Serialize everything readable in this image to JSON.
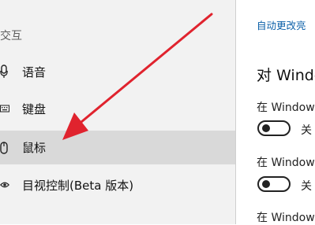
{
  "sidebar": {
    "section_header": "交互",
    "items": [
      {
        "label": "语音",
        "icon": "microphone-icon"
      },
      {
        "label": "键盘",
        "icon": "keyboard-icon"
      },
      {
        "label": "鼠标",
        "icon": "mouse-icon",
        "selected": true
      },
      {
        "label": "目视控制(Beta 版本)",
        "icon": "eye-control-icon"
      }
    ]
  },
  "main": {
    "link": "自动更改亮",
    "heading": "对 Windo",
    "settings": [
      {
        "label": "在 Window",
        "toggle_state": "关"
      },
      {
        "label": "在 Window",
        "toggle_state": "关"
      },
      {
        "label": "在 Window"
      }
    ]
  },
  "colors": {
    "sidebar_bg": "#f2f2f2",
    "selected_bg": "#d9d9d9",
    "link": "#0a5fa8",
    "arrow": "#e0232e"
  }
}
